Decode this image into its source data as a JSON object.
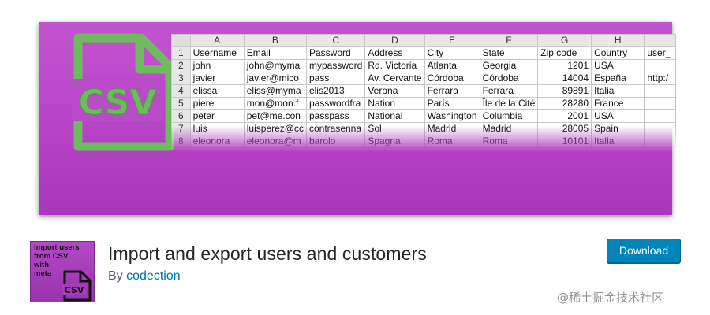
{
  "banner": {
    "icon_name": "csv-file-icon",
    "icon_label": "CSV",
    "icon_color": "#6dbb5e",
    "background_color": "#b94bc8",
    "spreadsheet": {
      "column_letters": [
        "A",
        "B",
        "C",
        "D",
        "E",
        "F",
        "G",
        "H",
        ""
      ],
      "rows": [
        {
          "n": "1",
          "cells": [
            "Username",
            "Email",
            "Password",
            "Address",
            "City",
            "State",
            "Zip code",
            "Country",
            "user_"
          ]
        },
        {
          "n": "2",
          "cells": [
            "john",
            "john@myma",
            "mypassword",
            "Rd. Victoria",
            "Atlanta",
            "Georgia",
            "1201",
            "USA",
            ""
          ]
        },
        {
          "n": "3",
          "cells": [
            "javier",
            "javier@mico",
            "pass",
            "Av. Cervante",
            "Córdoba",
            "Córdoba",
            "14004",
            "España",
            "http:/"
          ]
        },
        {
          "n": "4",
          "cells": [
            "elissa",
            "eliss@myma",
            "elis2013",
            "Verona",
            "Ferrara",
            "Ferrara",
            "89891",
            "Italia",
            ""
          ]
        },
        {
          "n": "5",
          "cells": [
            "piere",
            "mon@mon.f",
            "passwordfra",
            "Nation",
            "París",
            "Île de la Cité",
            "28280",
            "France",
            ""
          ]
        },
        {
          "n": "6",
          "cells": [
            "peter",
            "pet@me.con",
            "passpass",
            "National",
            "Washington",
            "Columbia",
            "2001",
            "USA",
            ""
          ]
        },
        {
          "n": "7",
          "cells": [
            "luis",
            "luisperez@cc",
            "contrasenna",
            "Sol",
            "Madrid",
            "Madrid",
            "28005",
            "Spain",
            ""
          ]
        },
        {
          "n": "8",
          "cells": [
            "eleonora",
            "eleonora@m",
            "barolo",
            "Spagna",
            "Roma",
            "Roma",
            "10101",
            "Italia",
            ""
          ]
        }
      ]
    }
  },
  "plugin": {
    "icon_text": [
      "Import users",
      "from CSV",
      "with",
      "meta"
    ],
    "icon_badge": "CSV",
    "title": "Import and export users and customers",
    "by_prefix": "By",
    "author": "codection",
    "download_label": "Download",
    "accent_color": "#0085ba"
  },
  "watermark": "@稀土掘金技术社区"
}
